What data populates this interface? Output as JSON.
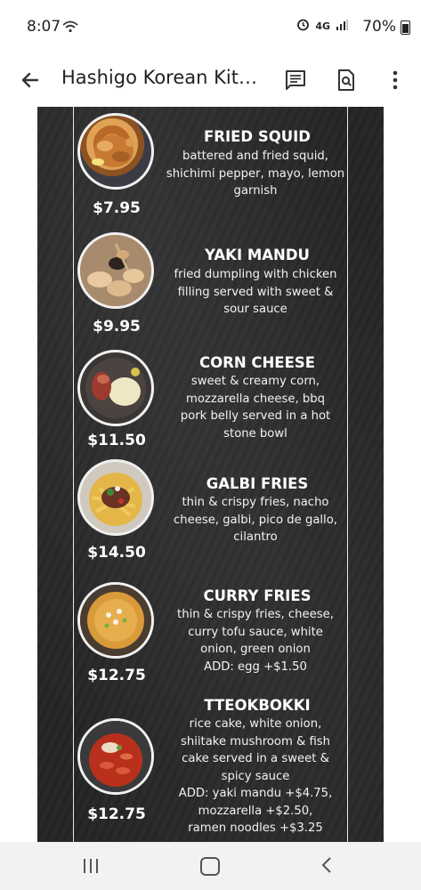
{
  "status_bar": {
    "time": "8:07",
    "network": "4G",
    "battery": "70%"
  },
  "app_bar": {
    "title": "Hashigo Korean Kitc..."
  },
  "icons": {
    "back": "arrow-left-icon",
    "comment": "comment-icon",
    "search_page": "find-in-page-icon",
    "more": "more-vert-icon"
  },
  "menu": {
    "items": [
      {
        "name": "FRIED SQUID",
        "description_lines": [
          "battered and fried squid,",
          "shichimi pepper, mayo, lemon",
          "garnish"
        ],
        "price": "$7.95"
      },
      {
        "name": "YAKI MANDU",
        "description_lines": [
          "fried dumpling with chicken",
          "filling served with sweet &",
          "sour sauce"
        ],
        "price": "$9.95"
      },
      {
        "name": "CORN CHEESE",
        "description_lines": [
          "sweet & creamy corn,",
          "mozzarella cheese, bbq",
          "pork belly served in a hot",
          "stone bowl"
        ],
        "price": "$11.50"
      },
      {
        "name": "GALBI FRIES",
        "description_lines": [
          "thin & crispy fries, nacho",
          "cheese, galbi, pico de gallo,",
          "cilantro"
        ],
        "price": "$14.50"
      },
      {
        "name": "CURRY FRIES",
        "description_lines": [
          "thin & crispy fries, cheese,",
          "curry tofu sauce, white",
          "onion, green onion",
          "ADD: egg +$1.50"
        ],
        "price": "$12.75"
      },
      {
        "name": "TTEOKBOKKI",
        "description_lines": [
          "rice cake, white onion,",
          "shiitake mushroom & fish",
          "cake served in a sweet &",
          "spicy sauce",
          "ADD: yaki mandu +$4.75,",
          "mozzarella +$2.50,",
          "ramen noodles +$3.25"
        ],
        "price": "$12.75"
      }
    ]
  },
  "colors": {
    "board": "#262626",
    "text": "#ffffff",
    "frame": "#e8e8e8"
  }
}
